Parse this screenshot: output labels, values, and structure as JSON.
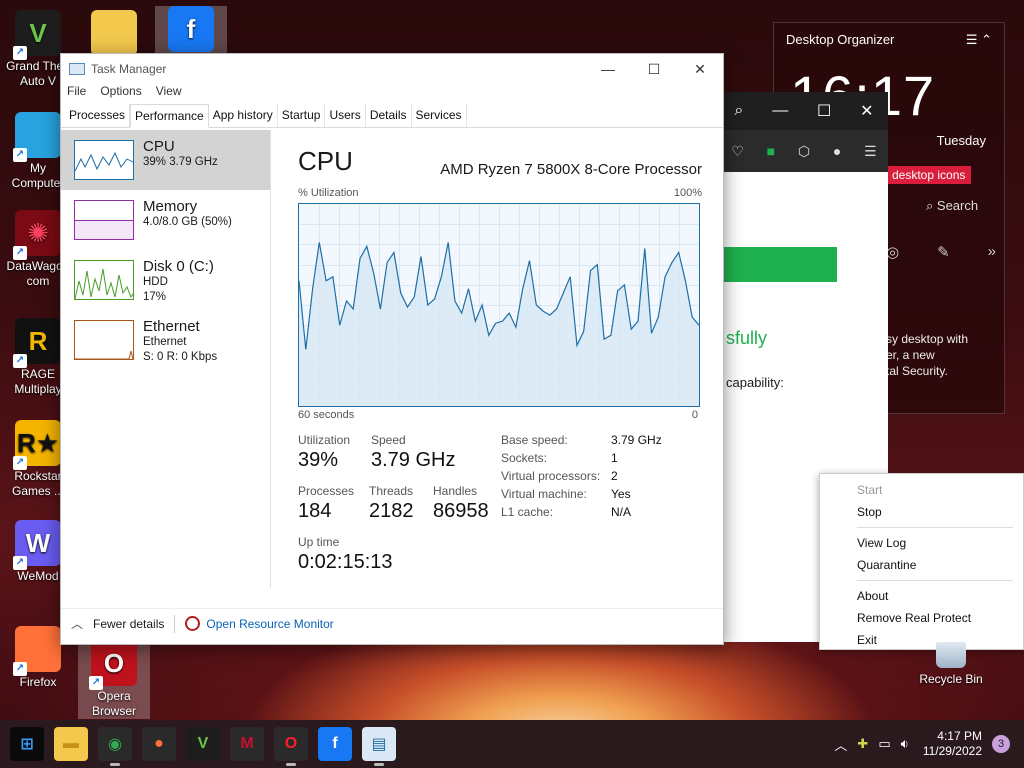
{
  "desktop": {
    "icons": [
      {
        "label": "Grand Theft Auto V",
        "glyph": "V",
        "color": "#1d1d1d",
        "fg": "#6cc24a"
      },
      {
        "label": "",
        "glyph": "",
        "color": "#f2c94c",
        "fg": "#fff"
      },
      {
        "label": "",
        "glyph": "f",
        "color": "#1877f2",
        "fg": "#fff"
      },
      {
        "label": "My Computer",
        "glyph": "",
        "color": "#29a3e0",
        "fg": "#fff"
      },
      {
        "label": "DataWagon com",
        "glyph": "✺",
        "color": "#7a0a14",
        "fg": "#ff4060"
      },
      {
        "label": "RAGE Multiplay",
        "glyph": "R",
        "color": "#111",
        "fg": "#f2b705"
      },
      {
        "label": "Rockstar Games ...",
        "glyph": "R★",
        "color": "#f4b400",
        "fg": "#111"
      },
      {
        "label": "WeMod",
        "glyph": "W",
        "color": "#6a5cf0",
        "fg": "#fff"
      },
      {
        "label": "Firefox",
        "glyph": "",
        "color": "#ff7139",
        "fg": "#fff"
      },
      {
        "label": "Opera Browser",
        "glyph": "O",
        "color": "#c0121c",
        "fg": "#fff"
      }
    ],
    "recycle_bin": "Recycle Bin"
  },
  "organizer": {
    "title": "Desktop Organizer",
    "time": "16:17",
    "day": "Tuesday",
    "pill": "desktop icons",
    "search": "Search",
    "desc_lines": [
      "sy desktop with",
      "er, a new",
      "tal Security."
    ]
  },
  "browser": {
    "text1": "sfully",
    "text2": "capability:"
  },
  "context_menu": {
    "items": [
      {
        "label": "Start",
        "disabled": true
      },
      {
        "label": "Stop",
        "disabled": false
      },
      {
        "label": "View Log",
        "disabled": false
      },
      {
        "label": "Quarantine",
        "disabled": false
      },
      {
        "label": "About",
        "disabled": false
      },
      {
        "label": "Remove Real Protect",
        "disabled": false
      },
      {
        "label": "Exit",
        "disabled": false
      }
    ]
  },
  "taskmanager": {
    "title": "Task Manager",
    "menu": [
      "File",
      "Options",
      "View"
    ],
    "tabs": [
      "Processes",
      "Performance",
      "App history",
      "Startup",
      "Users",
      "Details",
      "Services"
    ],
    "active_tab": "Performance",
    "resources": [
      {
        "name": "CPU",
        "sub1": "39% 3.79 GHz",
        "sub2": "",
        "sub3": "",
        "color": "#1f6fa7",
        "selected": true
      },
      {
        "name": "Memory",
        "sub1": "4.0/8.0 GB (50%)",
        "sub2": "",
        "sub3": "",
        "color": "#8b2fa3",
        "selected": false
      },
      {
        "name": "Disk 0 (C:)",
        "sub1": "HDD",
        "sub2": "17%",
        "sub3": "",
        "color": "#4a9d2a",
        "selected": false
      },
      {
        "name": "Ethernet",
        "sub1": "Ethernet",
        "sub2": "S: 0 R: 0 Kbps",
        "sub3": "",
        "color": "#a8541a",
        "selected": false
      }
    ],
    "cpu": {
      "heading": "CPU",
      "processor": "AMD Ryzen 7 5800X 8-Core Processor",
      "util_label": "% Utilization",
      "max_label": "100%",
      "time_label": "60 seconds",
      "min_label": "0",
      "utilization_label": "Utilization",
      "utilization": "39%",
      "speed_label": "Speed",
      "speed": "3.79 GHz",
      "processes_label": "Processes",
      "processes": "184",
      "threads_label": "Threads",
      "threads": "2182",
      "handles_label": "Handles",
      "handles": "86958",
      "uptime_label": "Up time",
      "uptime": "0:02:15:13",
      "specs": [
        {
          "k": "Base speed:",
          "v": "3.79 GHz"
        },
        {
          "k": "Sockets:",
          "v": "1"
        },
        {
          "k": "Virtual processors:",
          "v": "2"
        },
        {
          "k": "Virtual machine:",
          "v": "Yes"
        },
        {
          "k": "L1 cache:",
          "v": "N/A"
        }
      ],
      "graph_values": [
        62,
        28,
        58,
        81,
        62,
        64,
        40,
        52,
        48,
        73,
        79,
        66,
        48,
        71,
        76,
        56,
        49,
        54,
        74,
        50,
        53,
        64,
        81,
        52,
        46,
        58,
        42,
        50,
        35,
        41,
        42,
        46,
        39,
        58,
        72,
        50,
        47,
        45,
        48,
        56,
        64,
        30,
        37,
        67,
        70,
        33,
        35,
        57,
        60,
        38,
        42,
        78,
        36,
        44,
        64,
        71,
        76,
        62,
        44,
        40
      ]
    },
    "footer": {
      "fewer": "Fewer details",
      "monitor": "Open Resource Monitor"
    }
  },
  "taskbar": {
    "apps": [
      {
        "name": "start",
        "glyph": "⊞",
        "color": "#0a0a0a",
        "fg": "#3aa0ff",
        "active": false
      },
      {
        "name": "file-explorer",
        "glyph": "▬",
        "color": "#f2c94c",
        "fg": "#c8921a",
        "active": false
      },
      {
        "name": "chrome",
        "glyph": "◉",
        "color": "#2a2a2a",
        "fg": "#34a853",
        "active": true
      },
      {
        "name": "firefox",
        "glyph": "●",
        "color": "#2a2a2a",
        "fg": "#ff7139",
        "active": false
      },
      {
        "name": "gta",
        "glyph": "V",
        "color": "#1d1d1d",
        "fg": "#6cc24a",
        "active": false
      },
      {
        "name": "mcafee",
        "glyph": "M",
        "color": "#2a2a2a",
        "fg": "#c8102e",
        "active": false
      },
      {
        "name": "opera",
        "glyph": "O",
        "color": "#2a2a2a",
        "fg": "#ff1b2d",
        "active": true
      },
      {
        "name": "facebook",
        "glyph": "f",
        "color": "#1877f2",
        "fg": "#fff",
        "active": false
      },
      {
        "name": "task-manager",
        "glyph": "▤",
        "color": "#dbe9f6",
        "fg": "#1f6fa7",
        "active": true
      }
    ],
    "time": "4:17 PM",
    "date": "11/29/2022",
    "notifications": "3"
  }
}
